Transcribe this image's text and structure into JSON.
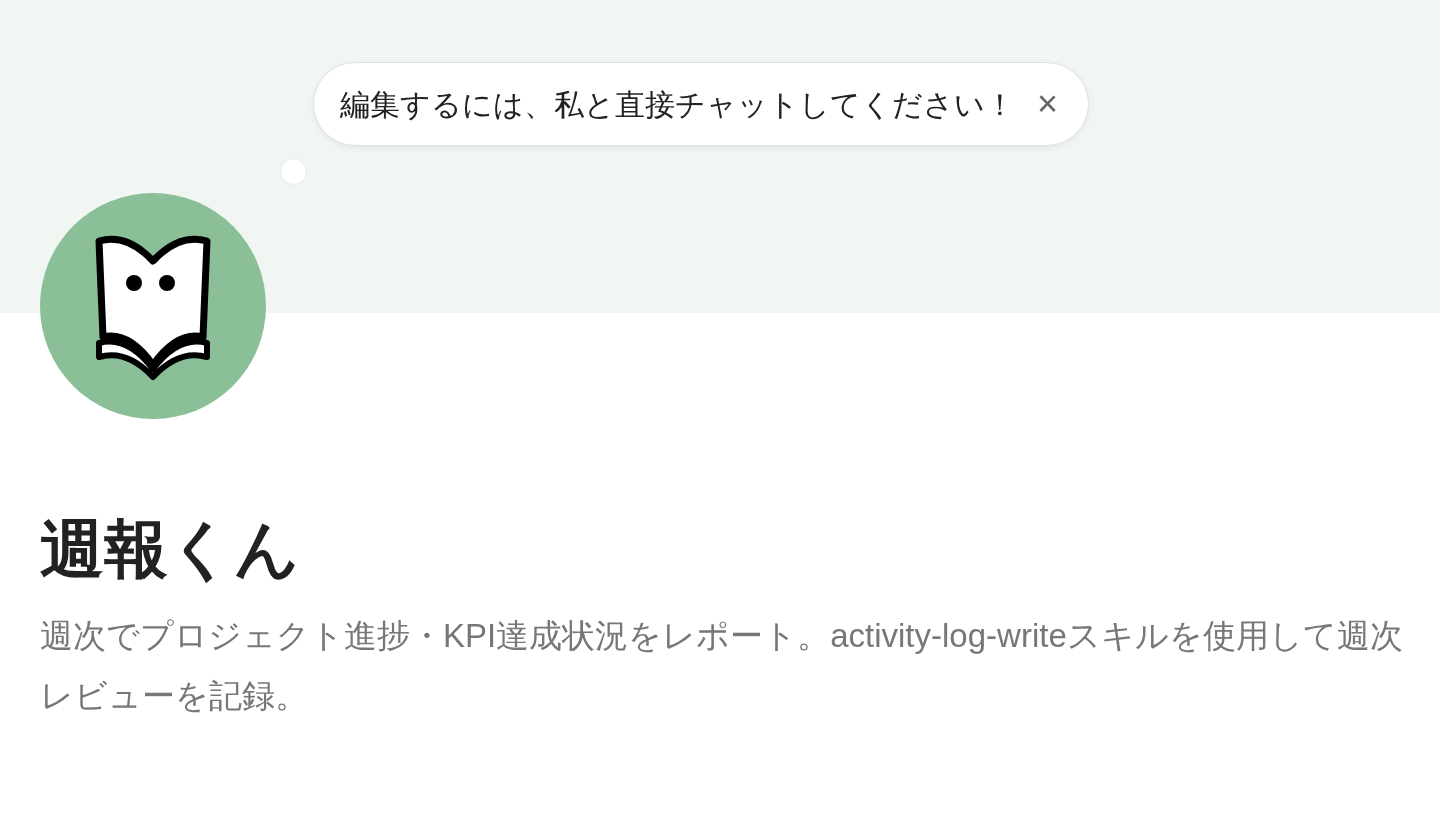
{
  "tooltip": {
    "text": "編集するには、私と直接チャットしてください！",
    "close": "×"
  },
  "title": "週報くん",
  "description": "週次でプロジェクト進捗・KPI達成状況をレポート。activity-log-writeスキルを使用して週次レビューを記録。"
}
